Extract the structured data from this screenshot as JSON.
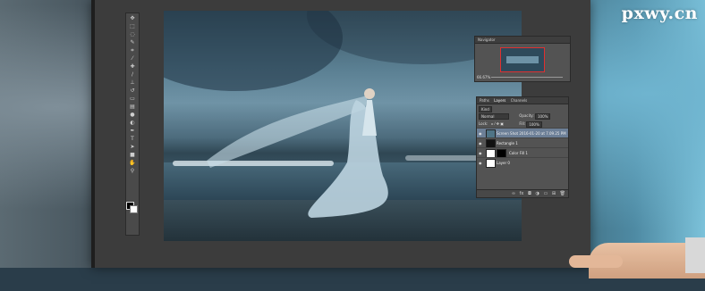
{
  "watermark": "pxwy.cn",
  "toolbar": {
    "tools": [
      "move-tool",
      "marquee-tool",
      "lasso-tool",
      "quick-select-tool",
      "crop-tool",
      "eyedropper-tool",
      "healing-tool",
      "brush-tool",
      "clone-stamp-tool",
      "history-brush-tool",
      "eraser-tool",
      "gradient-tool",
      "blur-tool",
      "dodge-tool",
      "pen-tool",
      "type-tool",
      "path-select-tool",
      "shape-tool",
      "hand-tool",
      "zoom-tool"
    ],
    "foreground_color": "#000000",
    "background_color": "#ffffff"
  },
  "navigator": {
    "tabs": [
      "Navigator"
    ],
    "zoom": "66.67%",
    "view_box_color": "#e03030"
  },
  "layers_panel": {
    "tabs": [
      "Paths",
      "Layers",
      "Channels"
    ],
    "filter_label": "Kind",
    "blend_mode": "Normal",
    "opacity_label": "Opacity:",
    "opacity": "100%",
    "lock_label": "Lock:",
    "fill_label": "Fill:",
    "fill": "100%",
    "layers": [
      {
        "name": "Screen Shot 2016-01-20 at 7.09.25 PM",
        "selected": true,
        "thumb": "photo"
      },
      {
        "name": "Rectangle 1",
        "selected": false,
        "thumb": "dark"
      },
      {
        "name": "Color Fill 1",
        "selected": false,
        "thumb": "white",
        "has_mask": true
      },
      {
        "name": "Layer 0",
        "selected": false,
        "thumb": "white"
      }
    ],
    "footer_icons": [
      "link-icon",
      "fx-icon",
      "mask-icon",
      "adjustment-icon",
      "folder-icon",
      "new-layer-icon",
      "trash-icon"
    ]
  },
  "accent_colors": {
    "selection": "#6c7f97",
    "panel": "#535353",
    "app_background": "#3c3c3c"
  }
}
